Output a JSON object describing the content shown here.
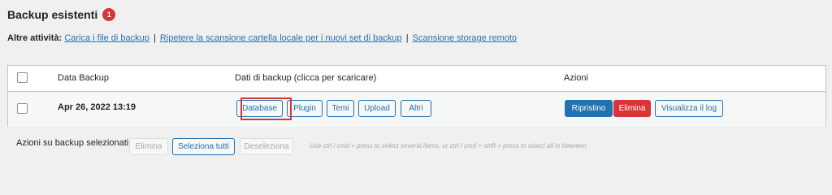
{
  "header": {
    "title": "Backup esistenti",
    "count": "1"
  },
  "activities": {
    "label": "Altre attività:",
    "links": [
      "Carica i file di backup",
      "Ripetere la scansione cartella locale per i nuovi set di backup",
      "Scansione storage remoto"
    ],
    "separator": "|"
  },
  "table": {
    "columns": {
      "date": "Data Backup",
      "data": "Dati di backup (clicca per scaricare)",
      "actions": "Azioni"
    },
    "rows": [
      {
        "date": "Apr 26, 2022 13:19",
        "data_buttons": [
          "Database",
          "Plugin",
          "Temi",
          "Upload",
          "Altri"
        ],
        "action_buttons": [
          "Ripristino",
          "Elimina",
          "Visualizza il log"
        ]
      }
    ]
  },
  "bulk": {
    "label": "Azioni su backup selezionati",
    "delete": "Elimina",
    "select_all": "Seleziona tutti",
    "deselect": "Deseleziona",
    "hint": "Use ctrl / cmd + press to select several items, or ctrl / cmd + shift + press to select all in between"
  },
  "colors": {
    "accent": "#2271b1",
    "danger": "#d63638",
    "highlight": "#d63638"
  }
}
